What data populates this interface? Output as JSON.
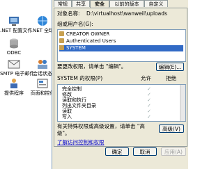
{
  "desktop": {
    "icons": [
      {
        "label": ".NET 配置文件",
        "glyph": "net-config-icon"
      },
      {
        "label": ".NET 全球",
        "glyph": "net-globe-icon"
      },
      {
        "label": "ODBC",
        "glyph": "odbc-icon"
      },
      {
        "label": "SMTP 电子邮件",
        "glyph": "smtp-email-icon"
      },
      {
        "label": "会话状态",
        "glyph": "session-state-icon"
      },
      {
        "label": "提供程序",
        "glyph": "provider-icon"
      },
      {
        "label": "页面和控件",
        "glyph": "pages-controls-icon"
      }
    ]
  },
  "dialog": {
    "tabs": [
      "常规",
      "共享",
      "安全",
      "以前的版本",
      "自定义"
    ],
    "active_tab": "安全",
    "object_label": "对象名称:",
    "object_value": "D:\\virtualhost\\wanweil\\uploads",
    "group_label": "组或用户名(G):",
    "users": [
      "CREATOR OWNER",
      "Authenticated Users",
      "SYSTEM"
    ],
    "selected_user": "SYSTEM",
    "change_hint": "要更改权限，请单击 \"编辑\"。",
    "edit_button": "编辑(E)...",
    "perm_label": "SYSTEM 的权限(P)",
    "allow_col": "允许",
    "deny_col": "拒绝",
    "permissions": [
      "完全控制",
      "修改",
      "读取和执行",
      "列出文件夹目录",
      "读取",
      "写入"
    ],
    "advanced_hint": "有关特殊权限或高级设置，请单击 \"高级\"。",
    "advanced_button": "高级(V)",
    "learn_link": "了解访问控制和权限",
    "ok_button": "确定",
    "cancel_button": "取消",
    "apply_button": "应用(A)"
  }
}
